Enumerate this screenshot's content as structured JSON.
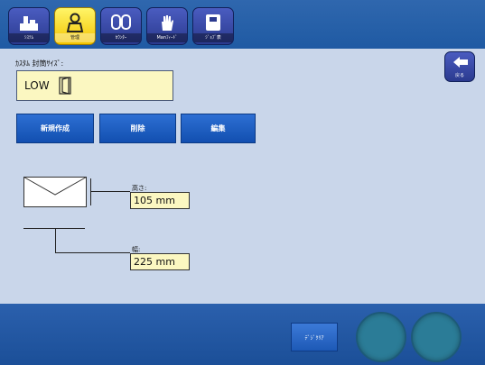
{
  "tabs": [
    {
      "label": "ｼｽﾃﾑ",
      "icon": "system-icon"
    },
    {
      "label": "管理",
      "icon": "person-icon",
      "active": true
    },
    {
      "label": "ｶｳﾝﾀｰ",
      "icon": "counter-icon"
    },
    {
      "label": "Manﾌｨｰﾄﾞ",
      "icon": "hand-feed-icon"
    },
    {
      "label": "ｼﾞｮﾌﾞ表",
      "icon": "job-list-icon"
    }
  ],
  "back": {
    "label": "戻る",
    "icon": "back-arrow-icon"
  },
  "custom_size": {
    "label": "ｶｽﾀﾑ 封筒ｻｲｽﾞ:",
    "value": "LOW"
  },
  "buttons": {
    "new": "新規作成",
    "delete": "削除",
    "edit": "編集"
  },
  "dimensions": {
    "height_label": "高さ:",
    "height_value": "105 mm",
    "width_label": "幅:",
    "width_value": "225 mm"
  },
  "bottom": {
    "digit_clear": "ﾃﾞｼﾞｸﾘｱ"
  },
  "colors": {
    "bar": "#1f5aa3",
    "active_tab": "#f2c400",
    "field_bg": "#fbf7c1",
    "background": "#c9d6ea"
  }
}
